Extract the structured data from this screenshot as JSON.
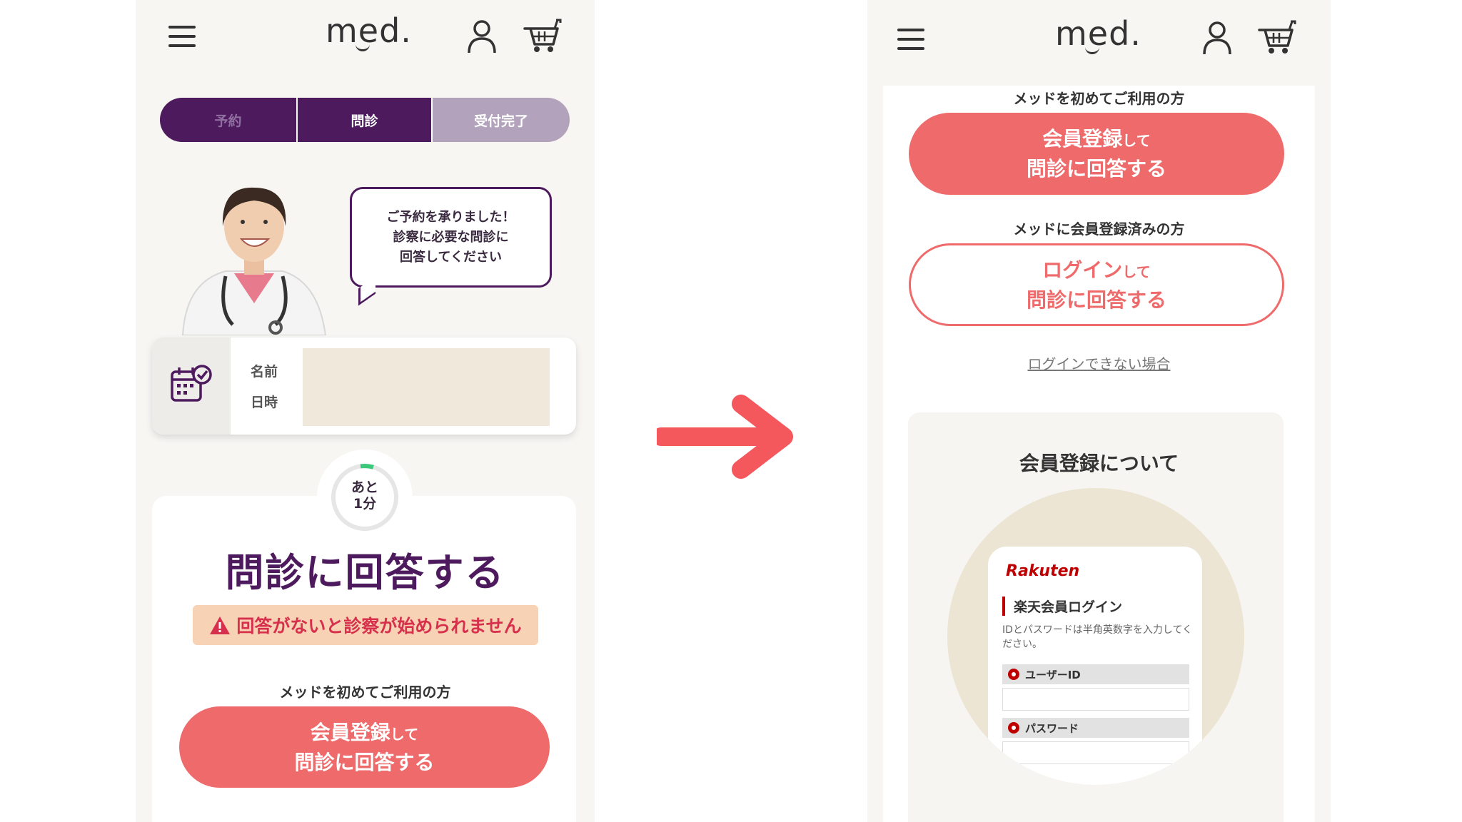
{
  "brand": {
    "logo": "med.",
    "accent": "#4e1a5e",
    "coral": "#ef6b6b"
  },
  "left": {
    "steps": [
      "予約",
      "問診",
      "受付完了"
    ],
    "bubble_lines": [
      "ご予約を承りました！",
      "診察に必要な問診に",
      "回答してください"
    ],
    "appointment": {
      "name_label": "名前",
      "datetime_label": "日時"
    },
    "timer": {
      "line1": "あと",
      "line2": "1分"
    },
    "title": "問診に回答する",
    "warning": "回答がないと診察が始められません",
    "new_user_caption": "メッドを初めてご利用の方",
    "register_button": {
      "main": "会員登録",
      "small": "して",
      "line2": "問診に回答する"
    }
  },
  "right": {
    "new_user_caption": "メッドを初めてご利用の方",
    "register_button": {
      "main": "会員登録",
      "small": "して",
      "line2": "問診に回答する"
    },
    "member_caption": "メッドに会員登録済みの方",
    "login_button": {
      "main": "ログイン",
      "small": "して",
      "line2": "問診に回答する"
    },
    "help_link": "ログインできない場合",
    "info_title": "会員登録について",
    "rakuten": {
      "logo": "Rakuten",
      "heading": "楽天会員ログイン",
      "desc": "IDとパスワードは半角英数字を入力してください。",
      "user_id_label": "ユーザーID",
      "password_label": "パスワード"
    }
  }
}
